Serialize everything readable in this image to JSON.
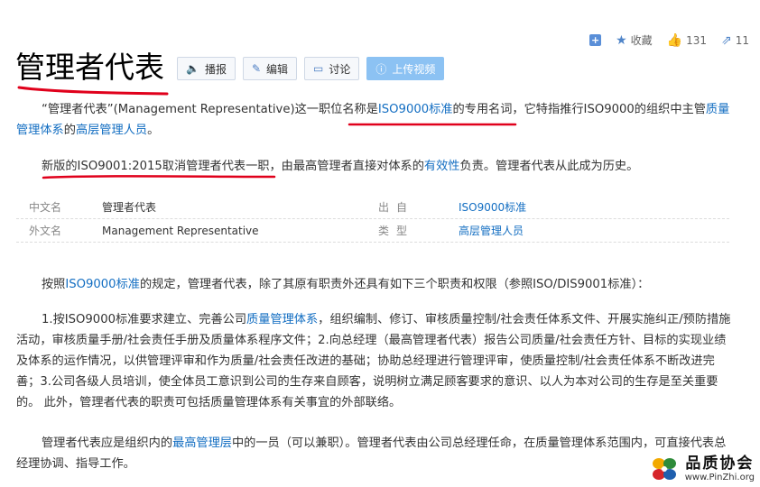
{
  "topbar": {
    "collect_label": "收藏",
    "like_count": "131",
    "share_count": "11"
  },
  "title": "管理者代表",
  "actions": {
    "play": "播报",
    "edit": "编辑",
    "discuss": "讨论",
    "upload_video": "上传视频"
  },
  "intro": {
    "p1_a": "“管理者代表”(Management Representative)这一职位名称是",
    "p1_link1": "ISO9000标准",
    "p1_b": "的专用名词，它特指推行ISO9000的组织中主管",
    "p1_link2": "质量管理体系",
    "p1_c": "的",
    "p1_link3": "高层管理人员",
    "p1_d": "。",
    "p2_a": "新版的ISO9001:2015取消管理者代表一职，由最高管理者直接对体系的",
    "p2_link": "有效性",
    "p2_b": "负责。管理者代表从此成为历史。"
  },
  "basic_info": [
    {
      "label": "中文名",
      "value": "管理者代表",
      "label2": "出自",
      "value2": "ISO9000标准"
    },
    {
      "label": "外文名",
      "value": "Management Representative",
      "label2": "类型",
      "value2": "高层管理人员"
    }
  ],
  "body": {
    "p3_a": "按照",
    "p3_link": "ISO9000标准",
    "p3_b": "的规定，管理者代表，除了其原有职责外还具有如下三个职责和权限（参照ISO/DIS9001标准）：",
    "p4_a": "1.按ISO9000标准要求建立、完善公司",
    "p4_link": "质量管理体系",
    "p4_b": "，组织编制、修订、审核质量控制/社会责任体系文件、开展实施纠正/预防措施活动，审核质量手册/社会责任手册及质量体系程序文件；2.向总经理（最高管理者代表）报告公司质量/社会责任方针、目标的实现业绩及体系的运作情况，以供管理评审和作为质量/社会责任改进的基础；协助总经理进行管理评审，使质量控制/社会责任体系不断改进完善；3.公司各级人员培训，使全体员工意识到公司的生存来自顾客，说明树立满足顾客要求的意识、以人为本对公司的生存是至关重要的。 此外，管理者代表的职责可包括质量管理体系有关事宜的外部联络。",
    "p5_a": "管理者代表应是组织内的",
    "p5_link": "最高管理层",
    "p5_b": "中的一员（可以兼职）。管理者代表由公司总经理任命，在质量管理体系范围内，可直接代表总经理协调、指导工作。"
  },
  "watermark": {
    "name": "品质协会",
    "url": "www.PinZhi.org"
  },
  "colors": {
    "link": "#136ec2",
    "annotation_red": "#e0001b",
    "primary_button": "#8cc2f3"
  }
}
